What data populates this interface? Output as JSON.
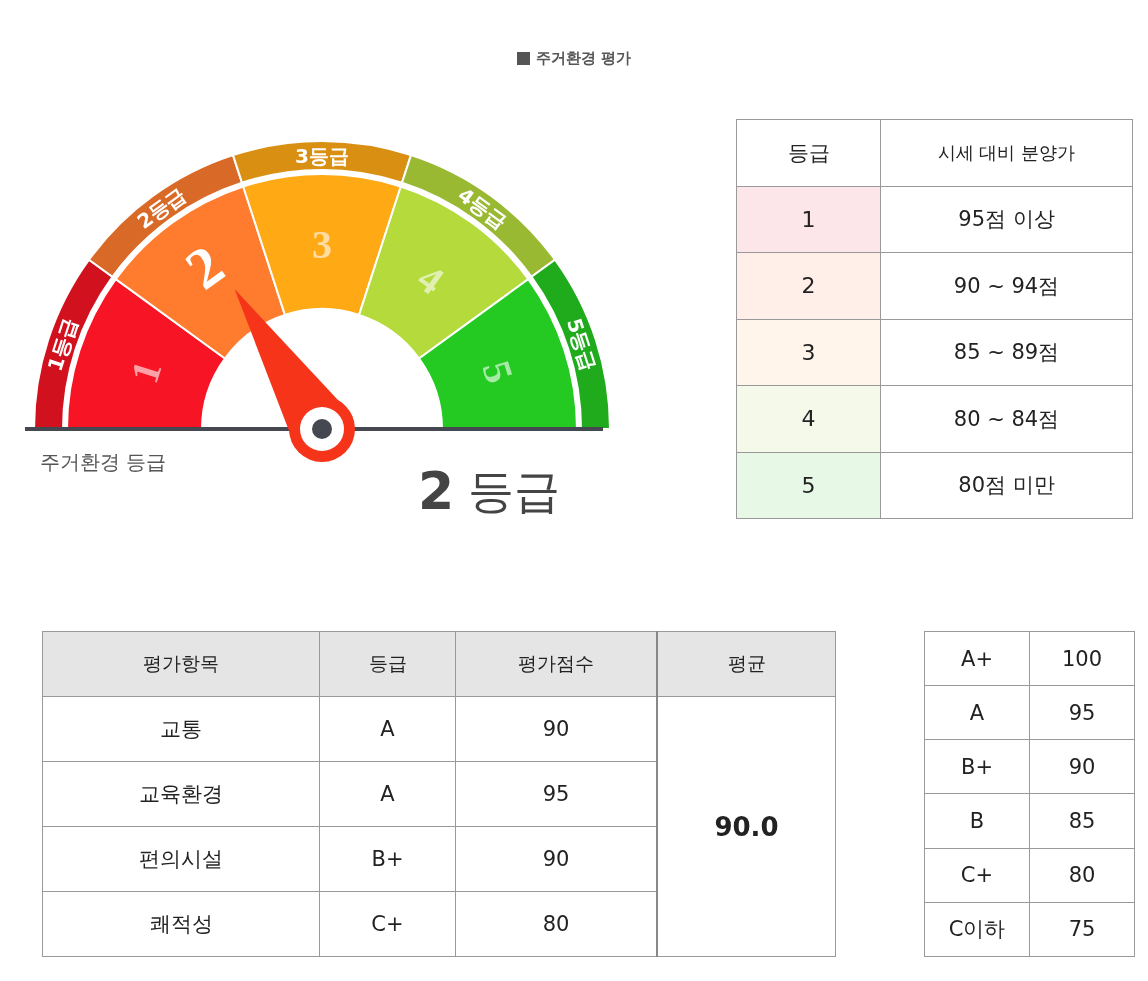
{
  "title": "주거환경 평가",
  "gauge": {
    "segments": [
      {
        "band_label": "1등급",
        "number": "1",
        "selected": false,
        "color": "#f71424"
      },
      {
        "band_label": "2등급",
        "number": "2",
        "selected": true,
        "color": "#ff7b2e"
      },
      {
        "band_label": "3등급",
        "number": "3",
        "selected": false,
        "color": "#ffa915"
      },
      {
        "band_label": "4등급",
        "number": "4",
        "selected": false,
        "color": "#b5da3c"
      },
      {
        "band_label": "5등급",
        "number": "5",
        "selected": false,
        "color": "#24c921"
      }
    ],
    "label": "주거환경 등급",
    "result_grade": "2",
    "result_unit": "등급"
  },
  "grade_table": {
    "columns": [
      "등급",
      "시세 대비 분양가"
    ],
    "rows": [
      {
        "grade": "1",
        "range": "95점 이상",
        "color": "#fde6ea"
      },
      {
        "grade": "2",
        "range": "90 ~ 94점",
        "color": "#ffefe8"
      },
      {
        "grade": "3",
        "range": "85 ~ 89점",
        "color": "#fff5ea"
      },
      {
        "grade": "4",
        "range": "80 ~ 84점",
        "color": "#f4f9ea"
      },
      {
        "grade": "5",
        "range": "80점 미만",
        "color": "#e8f8e7"
      }
    ]
  },
  "evaluation_table": {
    "columns": [
      "평가항목",
      "등급",
      "평가점수",
      "평균"
    ],
    "rows": [
      {
        "item": "교통",
        "grade": "A",
        "score": "90"
      },
      {
        "item": "교육환경",
        "grade": "A",
        "score": "95"
      },
      {
        "item": "편의시설",
        "grade": "B+",
        "score": "90"
      },
      {
        "item": "쾌적성",
        "grade": "C+",
        "score": "80"
      }
    ],
    "average": "90.0"
  },
  "score_table": {
    "rows": [
      {
        "grade": "A+",
        "score": "100"
      },
      {
        "grade": "A",
        "score": "95"
      },
      {
        "grade": "B+",
        "score": "90"
      },
      {
        "grade": "B",
        "score": "85"
      },
      {
        "grade": "C+",
        "score": "80"
      },
      {
        "grade": "C이하",
        "score": "75"
      }
    ]
  }
}
